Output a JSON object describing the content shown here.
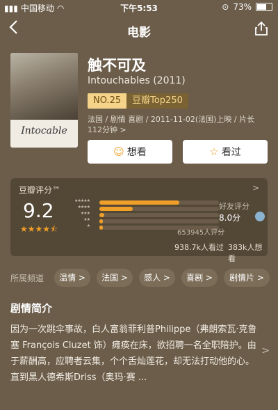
{
  "status_bar": {
    "carrier": "中国移动",
    "time": "下午5:53",
    "battery": "73%",
    "battery_level": 0.73
  },
  "nav": {
    "title": "电影"
  },
  "poster": {
    "text": "Intocable"
  },
  "movie": {
    "title": "触不可及",
    "original_title": "Intouchables (2011)",
    "rank": "NO.25",
    "ranking_list": "豆瓣Top250",
    "meta": "法国 / 剧情 喜剧 / 2011-11-02(法国)上映 / 片长112分钟 >"
  },
  "actions": {
    "want": "想看",
    "seen": "看过"
  },
  "rating": {
    "label": "豆瓣评分™",
    "score": "9.2",
    "stars": 4.5,
    "distribution": [
      {
        "stars": 5,
        "fraction": 0.67
      },
      {
        "stars": 4,
        "fraction": 0.28
      },
      {
        "stars": 3,
        "fraction": 0.04
      },
      {
        "stars": 2,
        "fraction": 0.01
      },
      {
        "stars": 1,
        "fraction": 0.01
      }
    ],
    "raters": "653945人评分",
    "friend_label": "好友评分",
    "friend_score": "8.0分",
    "watched": "938.7k人看过",
    "wants": "383k人想看"
  },
  "channels": {
    "label": "所属频道",
    "tags": [
      "温情 >",
      "法国 >",
      "感人 >",
      "喜剧 >",
      "剧情片 >"
    ]
  },
  "synopsis": {
    "title": "剧情简介",
    "text": "因为一次跳伞事故，白人富翁菲利普Philippe（弗朗索瓦·克鲁塞 François Cluzet 饰）瘫痪在床，欲招聘一名全职陪护。由于薪酬高，应聘者云集，个个舌灿莲花，却无法打动他的心。直到黑人德希斯Driss（奥玛·赛 ..."
  }
}
